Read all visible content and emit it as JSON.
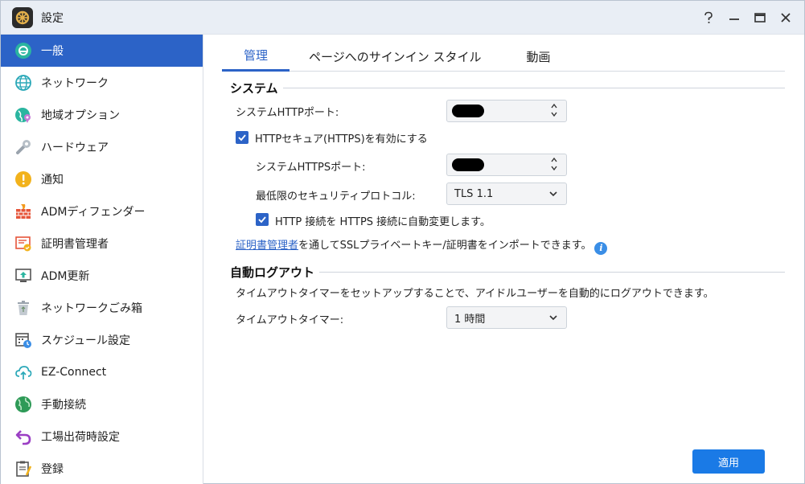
{
  "window": {
    "title": "設定",
    "controls": [
      "help-icon",
      "minimize-icon",
      "maximize-icon",
      "close-icon"
    ]
  },
  "sidebar": {
    "items": [
      {
        "label": "一般",
        "icon": "general-icon",
        "active": true
      },
      {
        "label": "ネットワーク",
        "icon": "network-globe-icon"
      },
      {
        "label": "地域オプション",
        "icon": "region-globe-pin-icon"
      },
      {
        "label": "ハードウェア",
        "icon": "hardware-wrench-icon"
      },
      {
        "label": "通知",
        "icon": "notification-exclamation-icon"
      },
      {
        "label": "ADMディフェンダー",
        "icon": "firewall-brick-icon"
      },
      {
        "label": "証明書管理者",
        "icon": "certificate-icon"
      },
      {
        "label": "ADM更新",
        "icon": "update-monitor-icon"
      },
      {
        "label": "ネットワークごみ箱",
        "icon": "recycle-bin-icon"
      },
      {
        "label": "スケジュール設定",
        "icon": "schedule-calendar-icon"
      },
      {
        "label": "EZ-Connect",
        "icon": "cloud-upload-icon"
      },
      {
        "label": "手動接続",
        "icon": "manual-connect-globe-icon"
      },
      {
        "label": "工場出荷時設定",
        "icon": "reset-arrow-icon"
      },
      {
        "label": "登録",
        "icon": "register-clipboard-icon"
      }
    ]
  },
  "tabs": [
    {
      "label": "管理",
      "active": true
    },
    {
      "label": "ページへのサインイン スタイル"
    },
    {
      "label": "動画"
    }
  ],
  "system": {
    "title": "システム",
    "http_port_label": "システムHTTPポート:",
    "https_checkbox_label": "HTTPセキュア(HTTPS)を有効にする",
    "https_enabled": true,
    "https_port_label": "システムHTTPSポート:",
    "min_protocol_label": "最低限のセキュリティプロトコル:",
    "min_protocol_value": "TLS 1.1",
    "redirect_label": "HTTP 接続を HTTPS 接続に自動変更します。",
    "redirect_enabled": true,
    "cert_link": "証明書管理者",
    "cert_text": "を通してSSLプライベートキー/証明書をインポートできます。"
  },
  "auto_logout": {
    "title": "自動ログアウト",
    "description": "タイムアウトタイマーをセットアップすることで、アイドルユーザーを自動的にログアウトできます。",
    "timer_label": "タイムアウトタイマー:",
    "timer_value": "1 時間"
  },
  "footer": {
    "apply_label": "適用"
  },
  "colors": {
    "accent": "#2c63c7",
    "apply": "#1a7ae6"
  }
}
